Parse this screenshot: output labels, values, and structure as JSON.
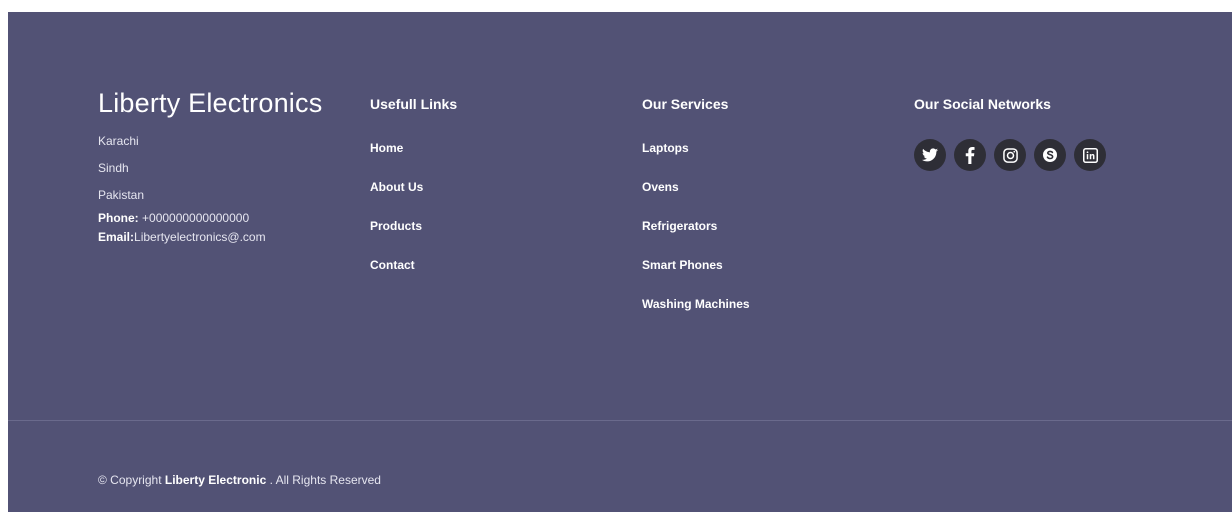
{
  "brand": {
    "title": "Liberty Electronics",
    "address": [
      "Karachi",
      "Sindh",
      "Pakistan"
    ],
    "phone_label": "Phone:",
    "phone_value": " +000000000000000",
    "email_label": "Email:",
    "email_value": "Libertyelectronics@.com"
  },
  "links": {
    "heading": "Usefull Links",
    "items": [
      "Home",
      "About Us",
      "Products",
      "Contact"
    ]
  },
  "services": {
    "heading": "Our Services",
    "items": [
      "Laptops",
      "Ovens",
      "Refrigerators",
      "Smart Phones",
      "Washing Machines"
    ]
  },
  "social": {
    "heading": "Our Social Networks",
    "icons": [
      "twitter-icon",
      "facebook-icon",
      "instagram-icon",
      "skype-icon",
      "linkedin-icon"
    ]
  },
  "copyright": {
    "prefix": "© Copyright ",
    "brand": "Liberty Electronic",
    "suffix": " . All Rights Reserved"
  },
  "colors": {
    "footer_bg": "#525275",
    "icon_bg": "#2e2e36",
    "text": "#ffffff"
  }
}
